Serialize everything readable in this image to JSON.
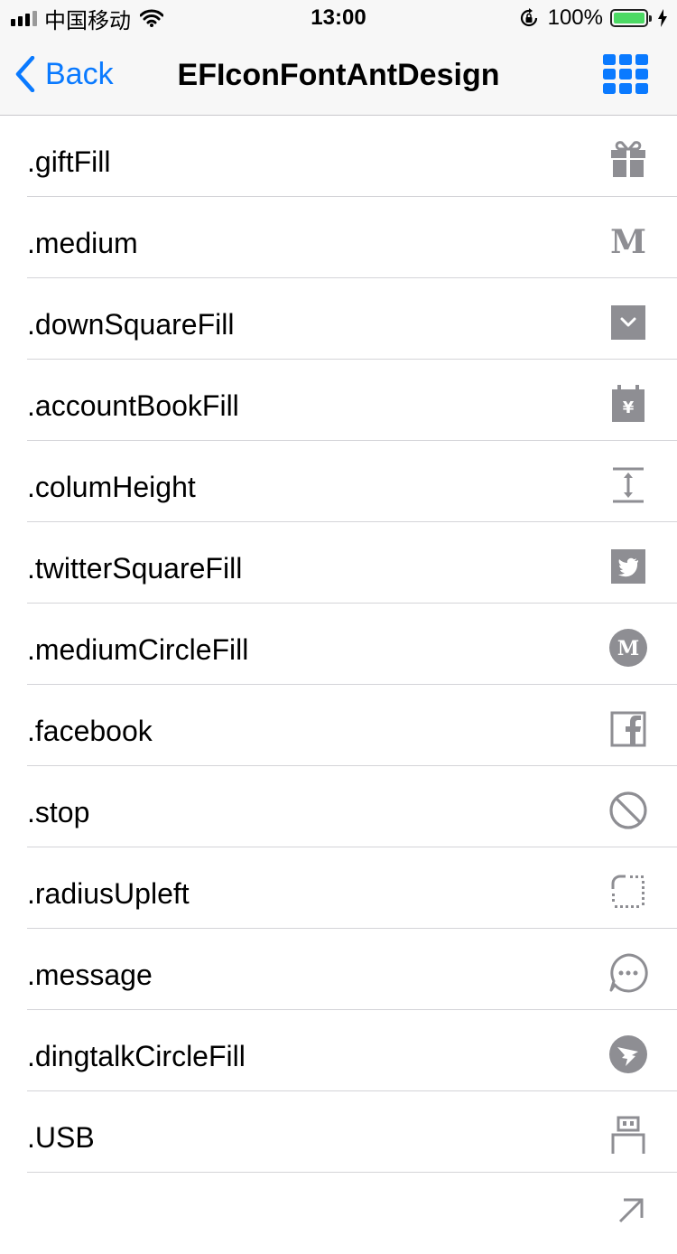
{
  "status_bar": {
    "carrier": "中国移动",
    "time": "13:00",
    "battery_pct": "100%",
    "battery_level": 1.0,
    "battery_color": "#4cd964"
  },
  "nav": {
    "back_label": "Back",
    "title": "EFIconFontAntDesign",
    "accent_color": "#0a7aff"
  },
  "rows": [
    {
      "label": ".giftFill",
      "icon": "gift-fill-icon"
    },
    {
      "label": ".medium",
      "icon": "medium-icon"
    },
    {
      "label": ".downSquareFill",
      "icon": "down-square-fill-icon"
    },
    {
      "label": ".accountBookFill",
      "icon": "account-book-fill-icon"
    },
    {
      "label": ".columHeight",
      "icon": "column-height-icon"
    },
    {
      "label": ".twitterSquareFill",
      "icon": "twitter-square-fill-icon"
    },
    {
      "label": ".mediumCircleFill",
      "icon": "medium-circle-fill-icon"
    },
    {
      "label": ".facebook",
      "icon": "facebook-icon"
    },
    {
      "label": ".stop",
      "icon": "stop-icon"
    },
    {
      "label": ".radiusUpleft",
      "icon": "radius-upleft-icon"
    },
    {
      "label": ".message",
      "icon": "message-icon"
    },
    {
      "label": ".dingtalkCircleFill",
      "icon": "dingtalk-circle-fill-icon"
    },
    {
      "label": ".USB",
      "icon": "usb-icon"
    },
    {
      "label": "",
      "icon": "arrow-up-right-icon"
    }
  ],
  "icon_color": "#8e8e93"
}
